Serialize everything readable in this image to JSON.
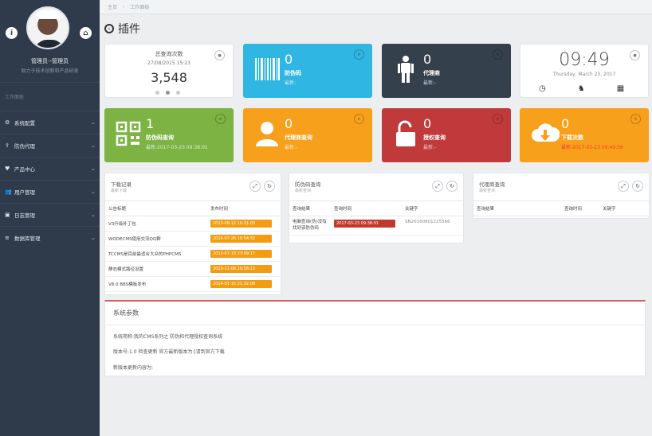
{
  "sidebar": {
    "profile_name": "管理员--管理员",
    "profile_sub": "致力于技术创新和产品研发",
    "nav_title": "工作面板",
    "items": [
      {
        "label": "系统配置",
        "icon": "gear-icon",
        "glyph": "⚙"
      },
      {
        "label": "防伪代理",
        "icon": "upload-icon",
        "glyph": "⇪"
      },
      {
        "label": "产品中心",
        "icon": "heart-icon",
        "glyph": "♥"
      },
      {
        "label": "用户管理",
        "icon": "users-icon",
        "glyph": "👥"
      },
      {
        "label": "日志管理",
        "icon": "log-icon",
        "glyph": "▣"
      },
      {
        "label": "数据库管理",
        "icon": "database-icon",
        "glyph": "≡"
      }
    ]
  },
  "breadcrumb": [
    "主页",
    "工作面板"
  ],
  "page_title": "插件",
  "stats": {
    "total": {
      "title": "总查询次数",
      "date": "27/08/2015 15:23",
      "value": "3,548"
    },
    "cards": [
      {
        "key": "antifake",
        "num": "0",
        "label": "防伪码",
        "sub": "最新:",
        "color": "#2fb6e2"
      },
      {
        "key": "agent",
        "num": "0",
        "label": "代理商",
        "sub": "最新:-",
        "color": "#34404c"
      },
      {
        "key": "query",
        "num": "1",
        "label": "防伪码查询",
        "sub": "最新:2017-03-23 09:38:01",
        "color": "#7cb342"
      },
      {
        "key": "agentquery",
        "num": "0",
        "label": "代理商查询",
        "sub": "最新:-",
        "color": "#f6a01c"
      },
      {
        "key": "auth",
        "num": "0",
        "label": "授权查询",
        "sub": "最新:-",
        "color": "#c0393b"
      },
      {
        "key": "download",
        "num": "0",
        "label": "下载次数",
        "sub": "最新:2017-03-23 09:49:36",
        "color": "#f6a01c"
      }
    ],
    "clock": {
      "time": "09:49",
      "date": "Thursday, March 23, 2017"
    }
  },
  "download_panel": {
    "title": "下载记录",
    "sub": "最新下载",
    "headers": [
      "公告标题",
      "发布时间"
    ],
    "rows": [
      [
        "V3升级补丁包",
        "2013-08-12 16:31:03"
      ],
      [
        "WODECMS使用交流QQ群",
        "2016-07-26 10:54:32"
      ],
      [
        "TCCMS是目前最适合大众的PHPCMS",
        "2013-07-10 23:09:17"
      ],
      [
        "静态模式路径设置",
        "2013-11-06 16:58:13"
      ],
      [
        "V8.0 BBS模板发布",
        "2014-01-15 21:32:08"
      ]
    ]
  },
  "query_panel": {
    "title": "防伪码查询",
    "sub": "最新查询",
    "headers": [
      "查询结果",
      "查询时间",
      "关键字"
    ],
    "row": [
      "电脑查询(伪)没有找到该防伪码",
      "2017-03-23 09:38:01",
      "SN20160801225566"
    ]
  },
  "agent_panel": {
    "title": "代理商查询",
    "sub": "最新查询",
    "headers": [
      "查询结果",
      "查询时间",
      "关键字"
    ]
  },
  "system": {
    "title": "系统参数",
    "line1": "系统简称:我的CMS系列之 防伪和代理授权查询系统",
    "line2": "版本号:1.0    检查更新    官方最新版本为:[请到官方下载",
    "line3": "新版本更新内容为:"
  },
  "colors": {
    "accent_red": "#d25d5d"
  }
}
